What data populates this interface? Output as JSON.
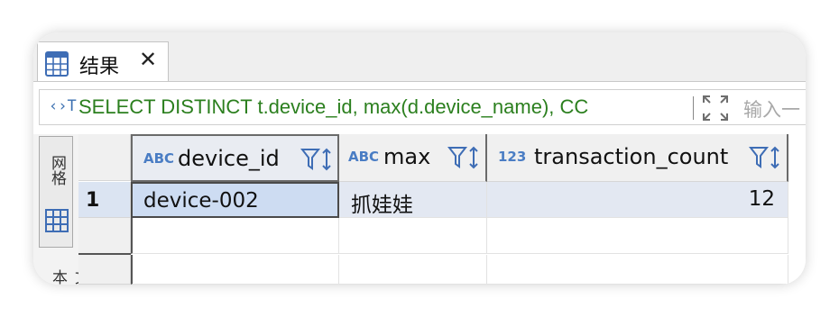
{
  "tab": {
    "label": "结果",
    "icon": "table-icon",
    "close": "✕"
  },
  "query": {
    "icon_text": "‹›T",
    "sql": "SELECT DISTINCT t.device_id, max(d.device_name), CC",
    "input_placeholder": "输入一",
    "expand_icon": "expand-icon"
  },
  "side": {
    "grid_label": "网格",
    "text_label": "文本"
  },
  "columns": [
    {
      "type": "ABC",
      "name": "device_id"
    },
    {
      "type": "ABC",
      "name": "max"
    },
    {
      "type": "123",
      "name": "transaction_count"
    }
  ],
  "rows": [
    {
      "num": "1",
      "cells": [
        "device-002",
        "抓娃娃",
        "12"
      ]
    }
  ],
  "colors": {
    "sql_green": "#2b7f1e",
    "type_blue": "#4a7dc4",
    "selection": "#cddcf2"
  }
}
